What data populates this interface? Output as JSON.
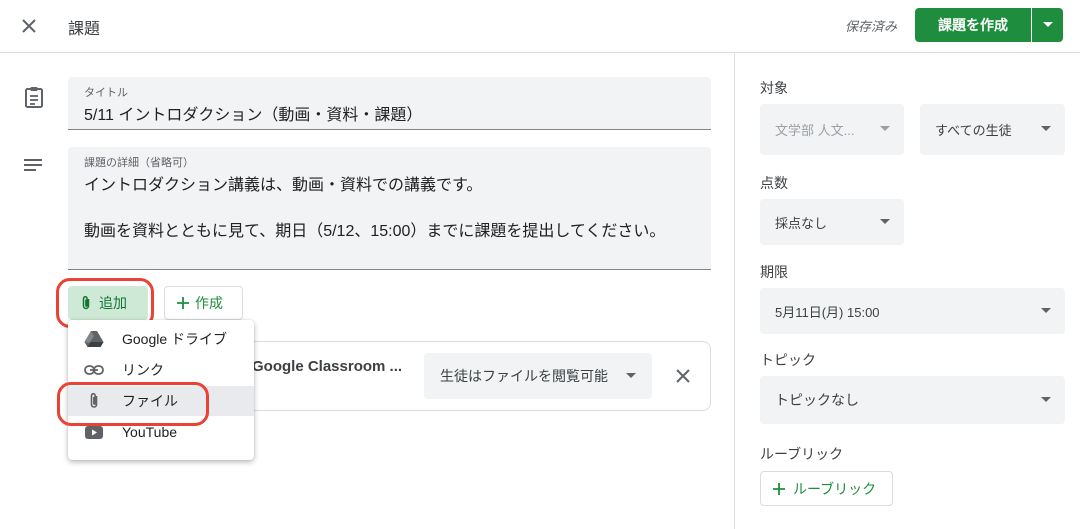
{
  "header": {
    "title": "課題",
    "saved_status": "保存済み",
    "create_button": "課題を作成"
  },
  "form": {
    "title_label": "タイトル",
    "title_value": "5/11 イントロダクション（動画・資料・課題）",
    "desc_label": "課題の詳細（省略可）",
    "desc_line1": "イントロダクション講義は、動画・資料での講義です。",
    "desc_line2": "動画を資料とともに見て、期日（5/12、15:00）までに課題を提出してください。"
  },
  "actions": {
    "add_label": "追加",
    "make_label": "作成"
  },
  "attachment": {
    "title": "Google Classroom ...",
    "permission": "生徒はファイルを閲覧可能"
  },
  "add_menu": {
    "items": [
      {
        "label": "Google ドライブ",
        "icon": "google-drive-icon"
      },
      {
        "label": "リンク",
        "icon": "link-icon"
      },
      {
        "label": "ファイル",
        "icon": "paperclip-icon"
      },
      {
        "label": "YouTube",
        "icon": "youtube-icon"
      }
    ],
    "highlighted": "ファイル"
  },
  "sidebar": {
    "target_label": "対象",
    "class_value": "文学部 人文...",
    "students_value": "すべての生徒",
    "points_label": "点数",
    "points_value": "採点なし",
    "due_label": "期限",
    "due_value": "5月11日(月) 15:00",
    "topic_label": "トピック",
    "topic_value": "トピックなし",
    "rubric_label": "ルーブリック",
    "rubric_button": "ルーブリック"
  },
  "colors": {
    "primary_green": "#1e8e3e",
    "add_button_bg": "#ceead6",
    "highlight_red": "#ea4335",
    "field_bg": "#f1f3f4"
  }
}
